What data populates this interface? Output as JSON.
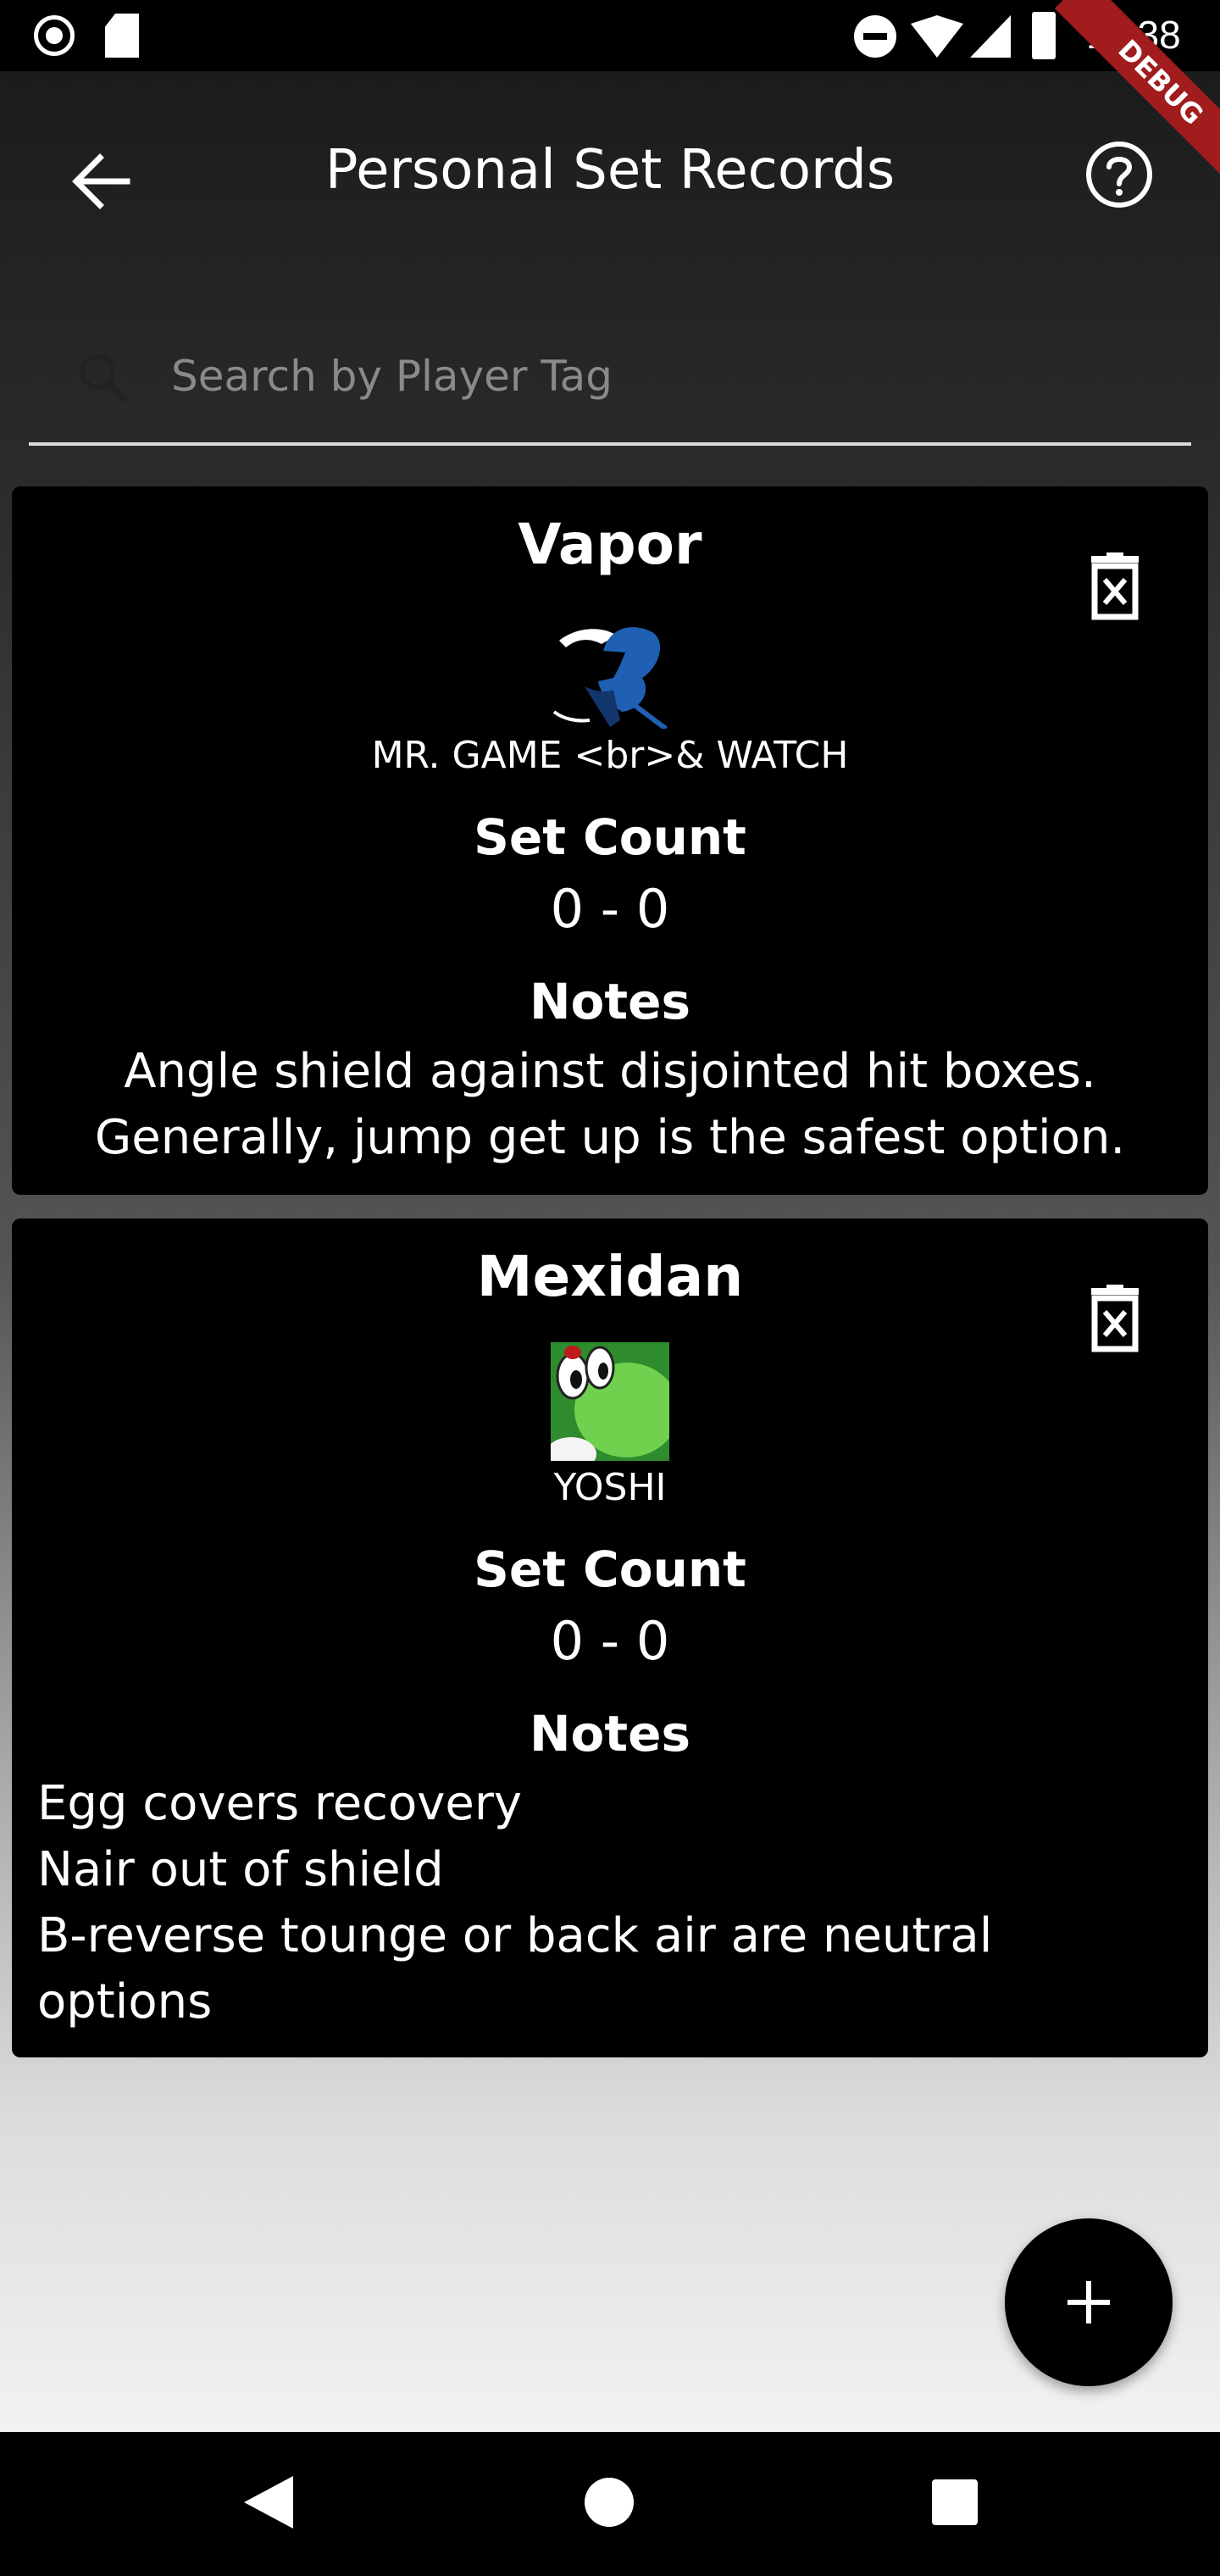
{
  "status_bar": {
    "time": "11:38",
    "icons": [
      "record-icon",
      "sd-card-icon",
      "do-not-disturb-icon",
      "wifi-icon",
      "signal-icon",
      "battery-icon"
    ]
  },
  "debug_banner": "DEBUG",
  "app_bar": {
    "title": "Personal Set Records",
    "back_icon": "arrow-back-icon",
    "help_icon": "help-circle-icon"
  },
  "search": {
    "placeholder": "Search by Player Tag",
    "value": "",
    "icon": "search-icon"
  },
  "records": [
    {
      "player_tag": "Vapor",
      "character": "MR. GAME <br>& WATCH",
      "character_icon": "mr-game-and-watch-icon",
      "set_count_label": "Set Count",
      "set_count": "0 - 0",
      "notes_label": "Notes",
      "notes": "Angle shield against disjointed hit boxes.\nGenerally, jump get up is the safest option.",
      "delete_icon": "delete-icon"
    },
    {
      "player_tag": "Mexidan",
      "character": "YOSHI",
      "character_icon": "yoshi-icon",
      "set_count_label": "Set Count",
      "set_count": "0 - 0",
      "notes_label": "Notes",
      "notes": "Egg covers recovery\nNair out of shield\nB-reverse tounge or back air are neutral\noptions",
      "delete_icon": "delete-icon"
    }
  ],
  "fab": {
    "icon": "plus-icon"
  },
  "nav_bar": {
    "icons": [
      "nav-back-icon",
      "nav-home-icon",
      "nav-recents-icon"
    ]
  },
  "colors": {
    "card_background": "#000000",
    "text": "#ffffff",
    "placeholder": "#8a8a8a",
    "debug_ribbon": "#a11c1c"
  }
}
